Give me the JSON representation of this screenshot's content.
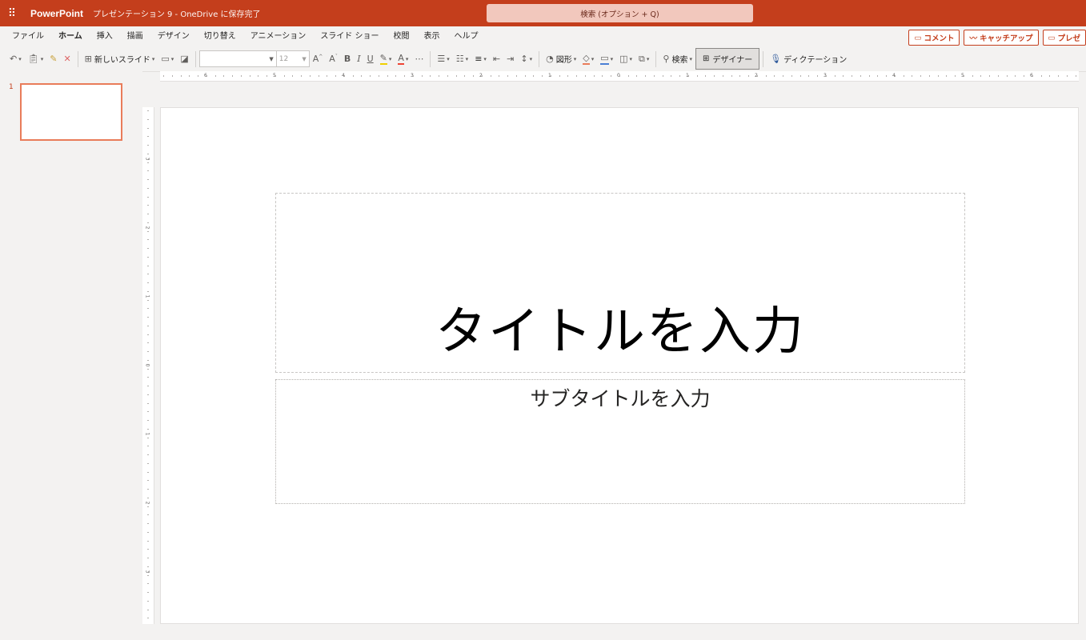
{
  "titlebar": {
    "app_name": "PowerPoint",
    "doc_title": "プレゼンテーション 9 - OneDrive に保存完了",
    "search_placeholder": "検索 (オプション + Q)"
  },
  "menu": {
    "tabs": [
      "ファイル",
      "ホーム",
      "挿入",
      "描画",
      "デザイン",
      "切り替え",
      "アニメーション",
      "スライド ショー",
      "校閲",
      "表示",
      "ヘルプ"
    ],
    "active_tab": "ホーム",
    "comment_label": "コメント",
    "catchup_label": "キャッチアップ",
    "present_label": "プレゼ"
  },
  "ribbon": {
    "new_slide_label": "新しいスライド",
    "font_size": "12",
    "shapes_label": "図形",
    "search_label": "検索",
    "designer_label": "デザイナー",
    "dictate_label": "ディクテーション"
  },
  "thumbnails": {
    "slide_number": "1"
  },
  "slide": {
    "title_placeholder": "タイトルを入力",
    "subtitle_placeholder": "サブタイトルを入力"
  },
  "rulers": {
    "horizontal_labels": [
      "6",
      "5",
      "4",
      "3",
      "2",
      "1",
      "0",
      "1",
      "2",
      "3",
      "4",
      "5",
      "6"
    ],
    "vertical_labels": [
      "3",
      "2",
      "1",
      "0",
      "1",
      "2",
      "3"
    ]
  },
  "colors": {
    "brand": "#c43e1c",
    "thumb_selected": "#e97c5a"
  }
}
